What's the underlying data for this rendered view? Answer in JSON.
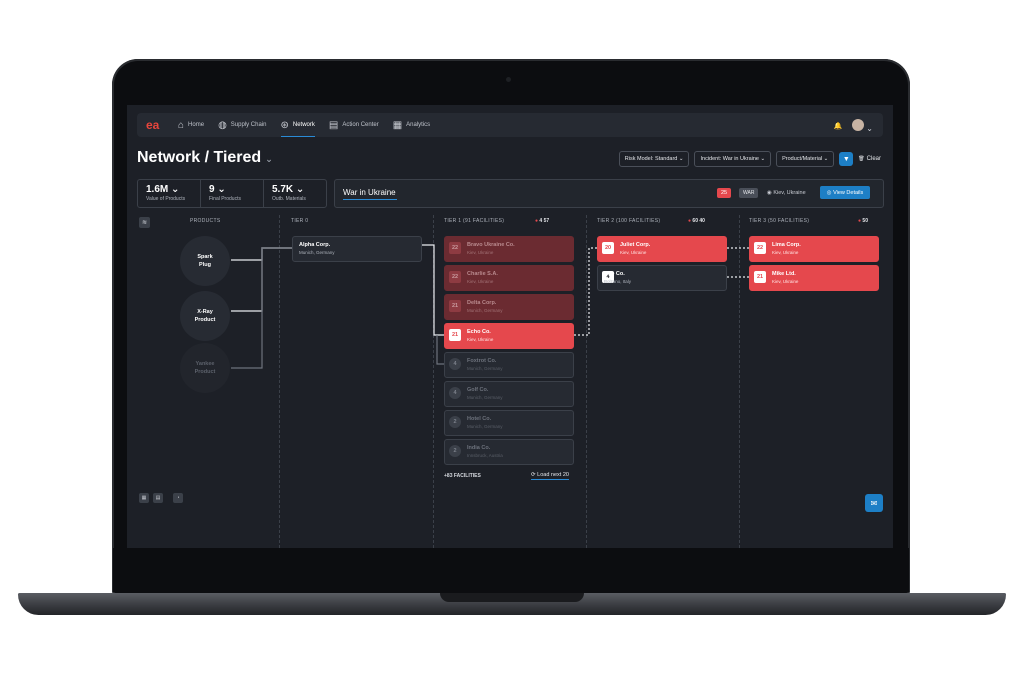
{
  "nav": {
    "logo": "ea",
    "items": [
      {
        "label": "Home",
        "icon": "home-icon",
        "glyph": "⌂"
      },
      {
        "label": "Supply Chain",
        "icon": "globe-icon",
        "glyph": "◍"
      },
      {
        "label": "Network",
        "icon": "network-icon",
        "glyph": "⊛",
        "active": true
      },
      {
        "label": "Action Center",
        "icon": "clipboard-icon",
        "glyph": "▤"
      },
      {
        "label": "Analytics",
        "icon": "chart-icon",
        "glyph": "▦"
      }
    ],
    "bell_glyph": "🔔",
    "chevron_glyph": "⌄"
  },
  "page": {
    "title": "Network / Tiered",
    "title_chevron": "⌄",
    "filters": {
      "risk_model": "Risk Model: Standard ⌄",
      "incident": "Incident: War in Ukraine ⌄",
      "product": "Product/Material ⌄",
      "clear": "Clear",
      "clear_glyph": "🗑"
    }
  },
  "stats": [
    {
      "value": "1.6M ⌄",
      "label": "Value of Products"
    },
    {
      "value": "9 ⌄",
      "label": "Final Products"
    },
    {
      "value": "5.7K ⌄",
      "label": "Outb. Materials"
    }
  ],
  "incident": {
    "name": "War in Ukraine",
    "count": "25",
    "type": "WAR",
    "location": "◉ Kiev, Ukraine",
    "view_label": "◎ View Details"
  },
  "columns": {
    "products": "PRODUCTS",
    "tier0": "TIER 0",
    "tier1": "TIER 1 (91 FACILITIES)",
    "tier1_counts": "4   57",
    "tier2": "TIER 2 (100 FACILITIES)",
    "tier2_counts": "60   40",
    "tier3": "TIER 3 (50 FACILITIES)",
    "tier3_counts": "50"
  },
  "products": [
    {
      "label": "Spark\nPlug"
    },
    {
      "label": "X-Ray\nProduct"
    },
    {
      "label": "Yankee\nProduct"
    }
  ],
  "tier0": [
    {
      "name": "Alpha Corp.",
      "loc": "Munich, Germany"
    }
  ],
  "tier1": [
    {
      "n": "22",
      "name": "Bravo Ukraine Co.",
      "loc": "Kiev, Ukraine",
      "state": "dim"
    },
    {
      "n": "22",
      "name": "Charlie S.A.",
      "loc": "Kiev, Ukraine",
      "state": "dim"
    },
    {
      "n": "21",
      "name": "Delta Corp.",
      "loc": "Munich, Germany",
      "state": "dim"
    },
    {
      "n": "21",
      "name": "Echo Co.",
      "loc": "Kiev, Ukraine",
      "state": "red"
    },
    {
      "n": "4",
      "name": "Foxtrot Co.",
      "loc": "Munich, Germany",
      "state": "grey"
    },
    {
      "n": "4",
      "name": "Golf Co.",
      "loc": "Munich, Germany",
      "state": "grey"
    },
    {
      "n": "2",
      "name": "Hotel Co.",
      "loc": "Munich, Germany",
      "state": "grey"
    },
    {
      "n": "2",
      "name": "India Co.",
      "loc": "Innsbruck, Austria",
      "state": "grey"
    }
  ],
  "tier1_footer": {
    "more": "+83 FACILITIES",
    "load": "⟳ Load next 20"
  },
  "tier2": [
    {
      "n": "20",
      "name": "Juliet Corp.",
      "loc": "Kiev, Ukraine",
      "state": "red"
    },
    {
      "n": "4",
      "name": "Kilo Co.",
      "loc": "Bolzano, Italy",
      "state": "plain"
    }
  ],
  "tier3": [
    {
      "n": "22",
      "name": "Lima Corp.",
      "loc": "Kiev, Ukraine",
      "state": "red"
    },
    {
      "n": "21",
      "name": "Mike Ltd.",
      "loc": "Kiev, Ukraine",
      "state": "red"
    }
  ],
  "colors": {
    "accent": "#1d7fc6",
    "alert": "#e5484d",
    "bg": "#1d2027"
  }
}
